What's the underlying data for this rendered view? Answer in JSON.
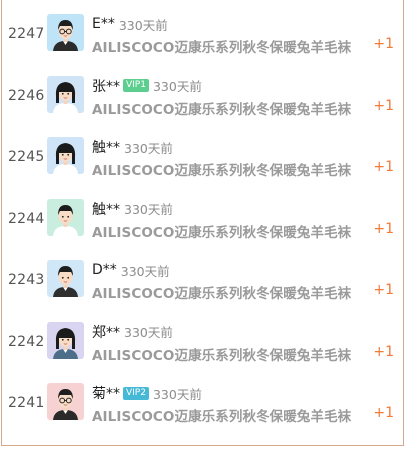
{
  "colors": {
    "border": "#d5a98f",
    "accent_plus": "#f07a36",
    "vip1": "#5ccf8e",
    "vip2": "#46b9d6"
  },
  "records": [
    {
      "id": "2247",
      "user": "E**",
      "vip": "",
      "ago": "330天前",
      "product": "AILISCOCO迈康乐系列秋冬保暖兔羊毛袜",
      "count": "+1",
      "avatar": "boy-glasses-blue"
    },
    {
      "id": "2246",
      "user": "张**",
      "vip": "VIP1",
      "ago": "330天前",
      "product": "AILISCOCO迈康乐系列秋冬保暖兔羊毛袜",
      "count": "+1",
      "avatar": "girl-blue"
    },
    {
      "id": "2245",
      "user": "触**",
      "vip": "",
      "ago": "330天前",
      "product": "AILISCOCO迈康乐系列秋冬保暖兔羊毛袜",
      "count": "+1",
      "avatar": "girl-blue"
    },
    {
      "id": "2244",
      "user": "触**",
      "vip": "",
      "ago": "330天前",
      "product": "AILISCOCO迈康乐系列秋冬保暖兔羊毛袜",
      "count": "+1",
      "avatar": "boy-green"
    },
    {
      "id": "2243",
      "user": "D**",
      "vip": "",
      "ago": "330天前",
      "product": "AILISCOCO迈康乐系列秋冬保暖兔羊毛袜",
      "count": "+1",
      "avatar": "boy-lightblue"
    },
    {
      "id": "2242",
      "user": "郑**",
      "vip": "",
      "ago": "330天前",
      "product": "AILISCOCO迈康乐系列秋冬保暖兔羊毛袜",
      "count": "+1",
      "avatar": "girl-lavender"
    },
    {
      "id": "2241",
      "user": "菊**",
      "vip": "VIP2",
      "ago": "330天前",
      "product": "AILISCOCO迈康乐系列秋冬保暖兔羊毛袜",
      "count": "+1",
      "avatar": "boy-glasses-pink"
    }
  ]
}
